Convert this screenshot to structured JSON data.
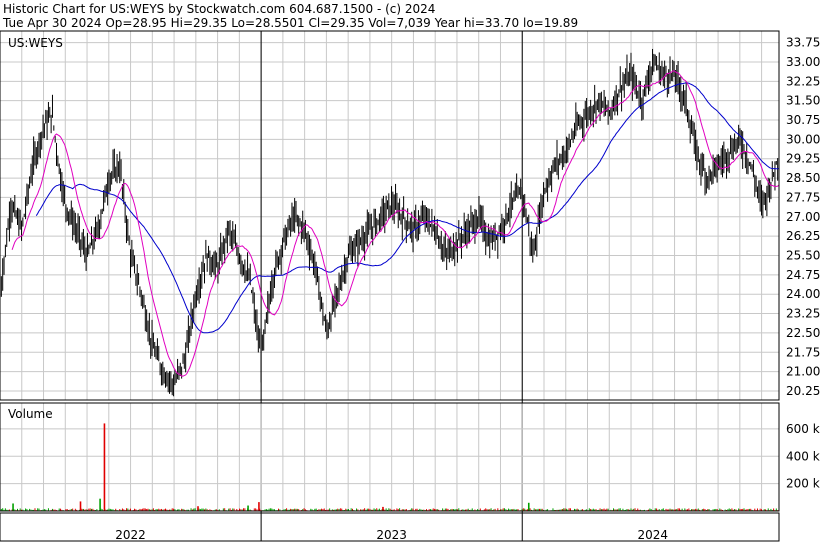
{
  "header": {
    "line1": "Historic Chart for US:WEYS by Stockwatch.com 604.687.1500 - (c) 2024",
    "line2": "Tue Apr 30 2024   Op=28.95   Hi=29.35   Lo=28.5501   Cl=29.35   Vol=7,039   Year hi=33.70   lo=19.89"
  },
  "colors": {
    "background": "#ffffff",
    "grid": "#c8c8c8",
    "price_bars": "#000000",
    "ma_short": "#e000c0",
    "ma_long": "#0000cc",
    "volume_up": "#00a000",
    "volume_down": "#e00000",
    "border": "#000000"
  },
  "chart_data": [
    {
      "type": "line",
      "subtype": "ohlc",
      "label": "US:WEYS",
      "ylim": [
        19.9,
        34.2
      ],
      "y_ticks": [
        "33.75",
        "33.00",
        "32.25",
        "31.50",
        "30.75",
        "30.00",
        "29.25",
        "28.50",
        "27.75",
        "27.00",
        "26.25",
        "25.50",
        "24.75",
        "24.00",
        "23.25",
        "22.50",
        "21.75",
        "21.00",
        "20.25"
      ],
      "y_tick_values": [
        33.75,
        33.0,
        32.25,
        31.5,
        30.75,
        30.0,
        29.25,
        28.5,
        27.75,
        27.0,
        26.25,
        25.5,
        24.75,
        24.0,
        23.25,
        22.5,
        21.75,
        21.0,
        20.25
      ],
      "x_labels": [
        "2022",
        "2023",
        "2024"
      ],
      "x_label_month_index": [
        6,
        18,
        30
      ],
      "year_boundaries_month_index": [
        12,
        24
      ],
      "x_range_months": [
        0,
        35.8
      ],
      "grid": true,
      "price_anchors": [
        [
          0,
          24
        ],
        [
          0.5,
          27.5
        ],
        [
          1,
          26.5
        ],
        [
          1.5,
          29
        ],
        [
          2,
          30.5
        ],
        [
          2.4,
          31
        ],
        [
          2.7,
          29
        ],
        [
          3,
          27.5
        ],
        [
          3.5,
          26.5
        ],
        [
          4,
          25.5
        ],
        [
          4.5,
          26.5
        ],
        [
          5,
          28.5
        ],
        [
          5.5,
          29
        ],
        [
          6,
          25.5
        ],
        [
          6.5,
          24
        ],
        [
          7,
          22
        ],
        [
          7.5,
          21
        ],
        [
          8,
          20.5
        ],
        [
          8.5,
          21.5
        ],
        [
          9,
          24
        ],
        [
          9.5,
          25.5
        ],
        [
          10,
          25
        ],
        [
          10.5,
          26.5
        ],
        [
          11,
          25.5
        ],
        [
          11.5,
          24.5
        ],
        [
          12,
          21.5
        ],
        [
          12.5,
          24.5
        ],
        [
          13,
          26
        ],
        [
          13.5,
          27
        ],
        [
          14,
          26.5
        ],
        [
          14.5,
          25
        ],
        [
          15,
          22.5
        ],
        [
          15.5,
          24
        ],
        [
          16,
          25.5
        ],
        [
          16.5,
          26
        ],
        [
          17,
          26.5
        ],
        [
          17.5,
          27
        ],
        [
          18,
          27.5
        ],
        [
          18.5,
          27
        ],
        [
          19,
          26.5
        ],
        [
          19.5,
          27
        ],
        [
          20,
          26.5
        ],
        [
          20.5,
          25.5
        ],
        [
          21,
          26
        ],
        [
          21.5,
          26.5
        ],
        [
          22,
          27
        ],
        [
          22.5,
          26
        ],
        [
          23,
          26.5
        ],
        [
          23.5,
          27.5
        ],
        [
          24,
          28
        ],
        [
          24.5,
          25.5
        ],
        [
          25,
          28
        ],
        [
          25.5,
          29
        ],
        [
          26,
          29.5
        ],
        [
          26.5,
          30.5
        ],
        [
          27,
          31
        ],
        [
          27.5,
          31.5
        ],
        [
          28,
          31
        ],
        [
          28.5,
          32
        ],
        [
          29,
          32.5
        ],
        [
          29.5,
          31.5
        ],
        [
          30,
          33
        ],
        [
          30.5,
          32.5
        ],
        [
          31,
          32.5
        ],
        [
          31.5,
          31.5
        ],
        [
          32,
          29.5
        ],
        [
          32.5,
          28.5
        ],
        [
          33,
          29
        ],
        [
          33.5,
          29.5
        ],
        [
          34,
          30
        ],
        [
          34.5,
          29
        ],
        [
          35,
          27.5
        ],
        [
          35.3,
          28
        ],
        [
          35.8,
          29.35
        ]
      ],
      "series": [
        {
          "name": "",
          "kind": "daily-ohlc-bars"
        },
        {
          "name": "",
          "kind": "moving-average-short"
        },
        {
          "name": "",
          "kind": "moving-average-long"
        }
      ]
    },
    {
      "type": "bar",
      "label": "Volume",
      "ylim": [
        0,
        760000
      ],
      "y_ticks": [
        "600 k",
        "400 k",
        "200 k"
      ],
      "y_tick_values": [
        600000,
        400000,
        200000
      ],
      "typical_volume": 12000,
      "spikes": [
        {
          "month_index": 4.8,
          "volume": 640000
        },
        {
          "month_index": 4.6,
          "volume": 90000
        },
        {
          "month_index": 3.7,
          "volume": 70000
        },
        {
          "month_index": 0.6,
          "volume": 55000
        },
        {
          "month_index": 11.9,
          "volume": 65000
        },
        {
          "month_index": 11.4,
          "volume": 40000
        },
        {
          "month_index": 9.1,
          "volume": 35000
        },
        {
          "month_index": 24.3,
          "volume": 60000
        },
        {
          "month_index": 17.6,
          "volume": 30000
        }
      ]
    }
  ]
}
